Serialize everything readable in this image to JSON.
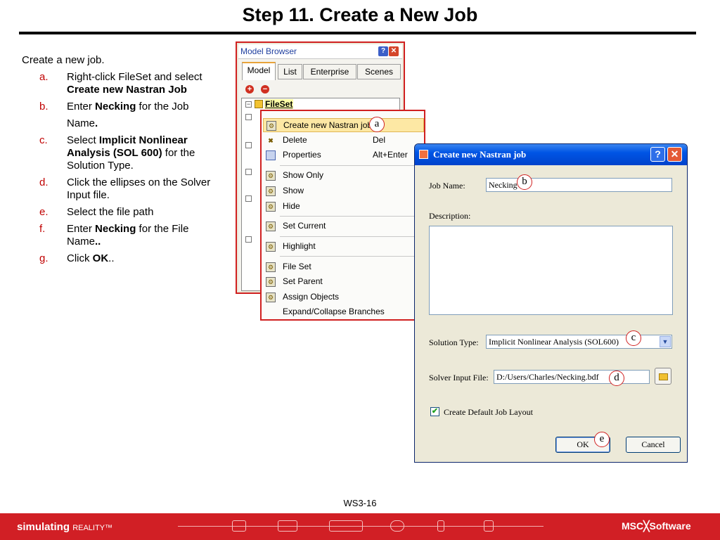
{
  "slide": {
    "title": "Step 11. Create a New Job",
    "intro": "Create a new job.",
    "steps": [
      {
        "letter": "a.",
        "text_pre": "Right-click FileSet and select ",
        "bold": "Create new Nastran Job",
        "text_post": ""
      },
      {
        "letter": "b.",
        "text_pre": "Enter ",
        "bold": "Necking",
        "text_post": " for the Job",
        "text_line2": "Name",
        "text_line2_bold": "."
      },
      {
        "letter": "c.",
        "text_pre": "Select ",
        "bold": "Implicit Nonlinear Analysis (SOL 600)",
        "text_post": " for the Solution Type."
      },
      {
        "letter": "d.",
        "text_pre": "Click the ellipses on the Solver Input file.",
        "bold": "",
        "text_post": ""
      },
      {
        "letter": "e.",
        "text_pre": "Select the file path",
        "bold": "",
        "text_post": ""
      },
      {
        "letter": "f.",
        "text_pre": "Enter ",
        "bold": "Necking",
        "text_post": " for the File",
        "text_line2": "Name",
        "text_line2_bold": ".."
      },
      {
        "letter": "g.",
        "text_pre": "Click ",
        "bold": "OK",
        "text_post": ".."
      }
    ],
    "page_number": "WS3-16"
  },
  "model_browser": {
    "title": "Model Browser",
    "tabs": [
      "Model",
      "List",
      "Enterprise",
      "Scenes"
    ],
    "active_tab": "Model",
    "tree_root": "FileSet"
  },
  "context_menu": {
    "items": [
      {
        "label": "Create new Nastran job",
        "shortcut": "",
        "icon": "gear-icon"
      },
      {
        "label": "Delete",
        "shortcut": "Del",
        "icon": "delete-icon"
      },
      {
        "label": "Properties",
        "shortcut": "Alt+Enter",
        "icon": "properties-icon"
      },
      {
        "label": "Show Only",
        "shortcut": "",
        "icon": "gear-icon"
      },
      {
        "label": "Show",
        "shortcut": "",
        "icon": "gear-icon"
      },
      {
        "label": "Hide",
        "shortcut": "",
        "icon": "gear-icon"
      },
      {
        "label": "Set Current",
        "shortcut": "",
        "icon": "gear-icon"
      },
      {
        "label": "Highlight",
        "shortcut": "",
        "icon": "gear-icon"
      },
      {
        "label": "File Set",
        "shortcut": "",
        "icon": "gear-icon"
      },
      {
        "label": "Set Parent",
        "shortcut": "",
        "icon": "gear-icon"
      },
      {
        "label": "Assign Objects",
        "shortcut": "",
        "icon": "gear-icon"
      },
      {
        "label": "Expand/Collapse Branches",
        "shortcut": "",
        "icon": ""
      }
    ]
  },
  "dialog": {
    "title": "Create new Nastran job",
    "job_name_label": "Job Name:",
    "job_name_value": "Necking",
    "description_label": "Description:",
    "description_value": "",
    "solution_type_label": "Solution Type:",
    "solution_type_value": "Implicit Nonlinear Analysis (SOL600)",
    "solver_input_label": "Solver Input File:",
    "solver_input_value": "D:/Users/Charles/Necking.bdf",
    "checkbox_label": "Create Default Job Layout",
    "checkbox_checked": true,
    "ok_label": "OK",
    "cancel_label": "Cancel"
  },
  "callouts": {
    "a": "a",
    "b": "b",
    "c": "c",
    "d": "d",
    "e": "e"
  },
  "footer": {
    "tagline": "simulating",
    "tagline_small": "REALITY™",
    "logo": "MSC╳Software"
  },
  "colors": {
    "accent_red": "#d11f25",
    "step_letter": "#c00000",
    "xp_title_blue": "#0055e5"
  }
}
